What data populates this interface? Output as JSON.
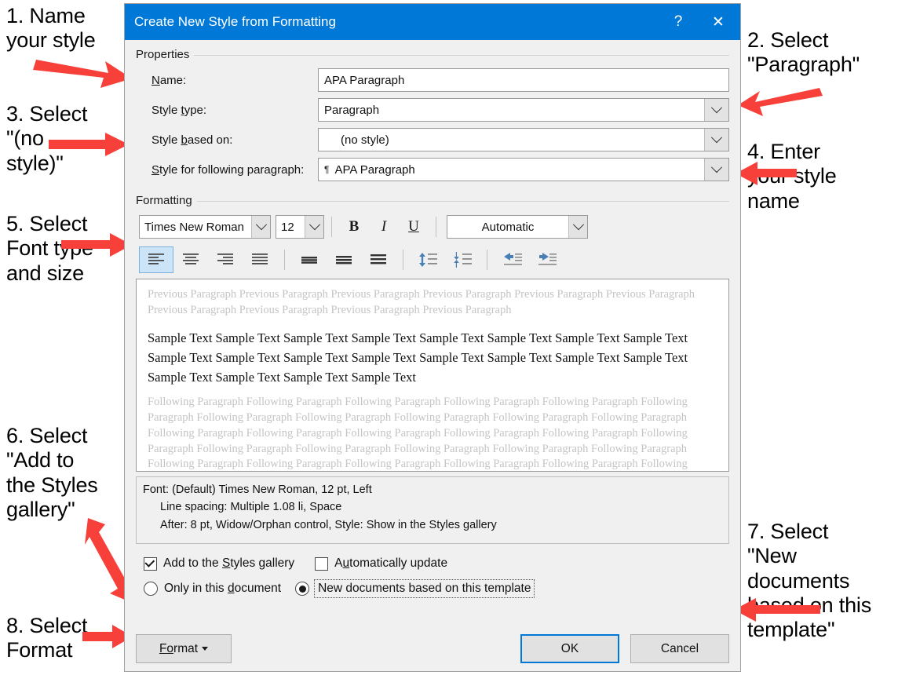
{
  "colors": {
    "titlebar": "#0078D7",
    "dialog_bg": "#F0F0F0",
    "accent_arrow": "#F8403A",
    "focus_border": "#0078D7",
    "active_tool": "#CCE4F7"
  },
  "dialog": {
    "title": "Create New Style from Formatting",
    "help_icon": "?",
    "close_icon": "✕"
  },
  "properties": {
    "group_label": "Properties",
    "name_label": "Name:",
    "name_label_pre": "N",
    "name_label_post": "ame:",
    "name_value": "APA Paragraph",
    "style_type_label_pre": "Style ",
    "style_type_label_mid": "t",
    "style_type_label_post": "ype:",
    "style_type_value": "Paragraph",
    "style_based_on_pre": "Style ",
    "style_based_on_mid": "b",
    "style_based_on_post": "ased on:",
    "style_based_on_value": "(no style)",
    "style_following_pre": "S",
    "style_following_mid": "t",
    "style_following_post": "yle for following paragraph:",
    "style_following_value": "APA Paragraph",
    "style_following_glyph": "¶"
  },
  "formatting": {
    "group_label": "Formatting",
    "font_name": "Times New Roman",
    "font_size": "12",
    "bold_label": "B",
    "italic_label": "I",
    "underline_label": "U",
    "font_color": "Automatic"
  },
  "preview": {
    "previous_paragraph": "Previous Paragraph Previous Paragraph Previous Paragraph Previous Paragraph Previous Paragraph Previous Paragraph Previous Paragraph Previous Paragraph Previous Paragraph Previous Paragraph",
    "sample_text": "Sample Text Sample Text Sample Text Sample Text Sample Text Sample Text Sample Text Sample Text Sample Text Sample Text Sample Text Sample Text Sample Text Sample Text Sample Text Sample Text Sample Text Sample Text Sample Text Sample Text",
    "following_paragraph": "Following Paragraph Following Paragraph Following Paragraph Following Paragraph Following Paragraph Following Paragraph Following Paragraph Following Paragraph Following Paragraph Following Paragraph Following Paragraph Following Paragraph Following Paragraph Following Paragraph Following Paragraph Following Paragraph Following Paragraph Following Paragraph Following Paragraph Following Paragraph Following Paragraph Following Paragraph Following Paragraph Following Paragraph Following Paragraph Following Paragraph Following Paragraph Following Paragraph Following Paragraph Following Paragraph Following Paragraph Following Paragraph Following Paragraph Following Paragraph Following Paragraph"
  },
  "description": {
    "line1": "Font: (Default) Times New Roman, 12 pt, Left",
    "line2": "Line spacing:  Multiple 1.08 li, Space",
    "line3": "After:  8 pt, Widow/Orphan control, Style: Show in the Styles gallery"
  },
  "options": {
    "add_gallery_pre": "Add to the ",
    "add_gallery_mid": "S",
    "add_gallery_post": "tyles gallery",
    "add_gallery_checked": true,
    "auto_update_pre": "A",
    "auto_update_mid": "u",
    "auto_update_post": "tomatically update",
    "auto_update_checked": false,
    "only_this_doc_pre": "Only in this ",
    "only_this_doc_mid": "d",
    "only_this_doc_post": "ocument",
    "only_this_doc_selected": false,
    "new_docs_label": "New documents based on this template",
    "new_docs_selected": true
  },
  "buttons": {
    "format_pre": "F",
    "format_mid": "o",
    "format_post": "rmat",
    "ok": "OK",
    "cancel": "Cancel"
  },
  "annotations": [
    {
      "id": "a1",
      "text": "1. Name\nyour style"
    },
    {
      "id": "a2",
      "text": "2. Select\n\"Paragraph\""
    },
    {
      "id": "a3",
      "text": "3. Select\n\"(no\nstyle)\""
    },
    {
      "id": "a4",
      "text": "4. Enter\nyour style\nname"
    },
    {
      "id": "a5",
      "text": "5. Select\nFont type\nand size"
    },
    {
      "id": "a6",
      "text": "6. Select\n\"Add to\nthe Styles\ngallery\""
    },
    {
      "id": "a7",
      "text": "7. Select\n\"New\ndocuments\nbased on this\ntemplate\""
    },
    {
      "id": "a8",
      "text": "8. Select\nFormat"
    }
  ]
}
